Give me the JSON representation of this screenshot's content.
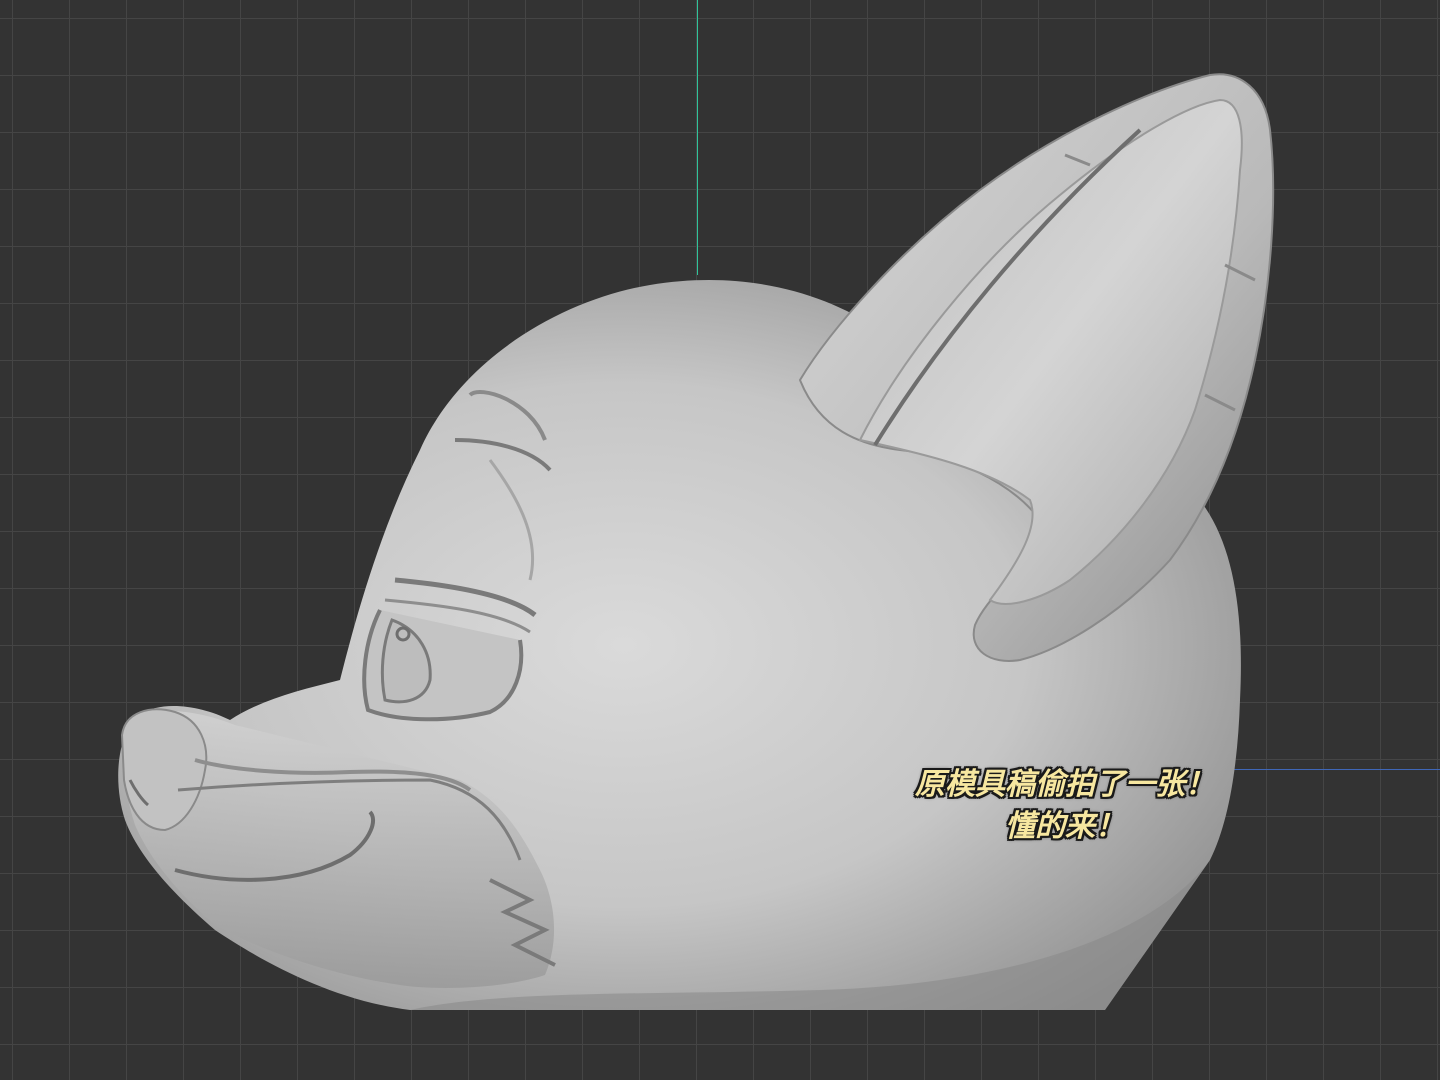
{
  "caption": {
    "line1": "原模具稿偷拍了一张！",
    "line2": "懂的来！",
    "color": "#f7e7a0"
  },
  "viewport": {
    "background_color": "#333333",
    "grid_color": "#454545",
    "axis_y_color": "#2fc49a",
    "axis_x_color": "#3f67b8"
  },
  "model": {
    "subject": "fox-head-sculpt",
    "surface_color": "#c8c8c8"
  }
}
